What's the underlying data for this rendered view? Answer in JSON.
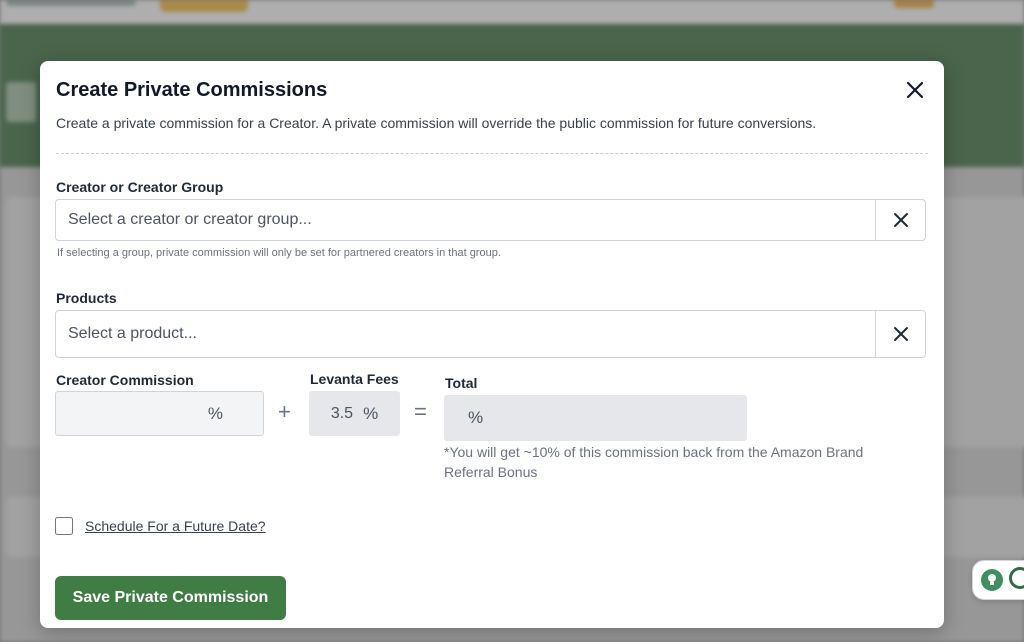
{
  "modal": {
    "title": "Create Private Commissions",
    "description": "Create a private commission for a Creator. A private commission will override the public commission for future conversions."
  },
  "creator_field": {
    "label": "Creator or Creator Group",
    "placeholder": "Select a creator or creator group...",
    "helper": "If selecting a group, private commission will only be set for partnered creators in that group."
  },
  "products_field": {
    "label": "Products",
    "placeholder": "Select a product..."
  },
  "commission": {
    "creator_label": "Creator Commission",
    "creator_value": "",
    "percent_symbol": "%",
    "plus": "+",
    "fees_label": "Levanta Fees",
    "fees_value": "3.5",
    "equals": "=",
    "total_label": "Total",
    "total_value": "",
    "note": "*You will get ~10% of this commission back from the Amazon Brand Referral Bonus"
  },
  "schedule": {
    "label": "Schedule For a Future Date?",
    "checked": false
  },
  "actions": {
    "save_label": "Save Private Commission"
  },
  "colors": {
    "primary": "#3f7d44",
    "header_bg": "#3c6e3f"
  }
}
